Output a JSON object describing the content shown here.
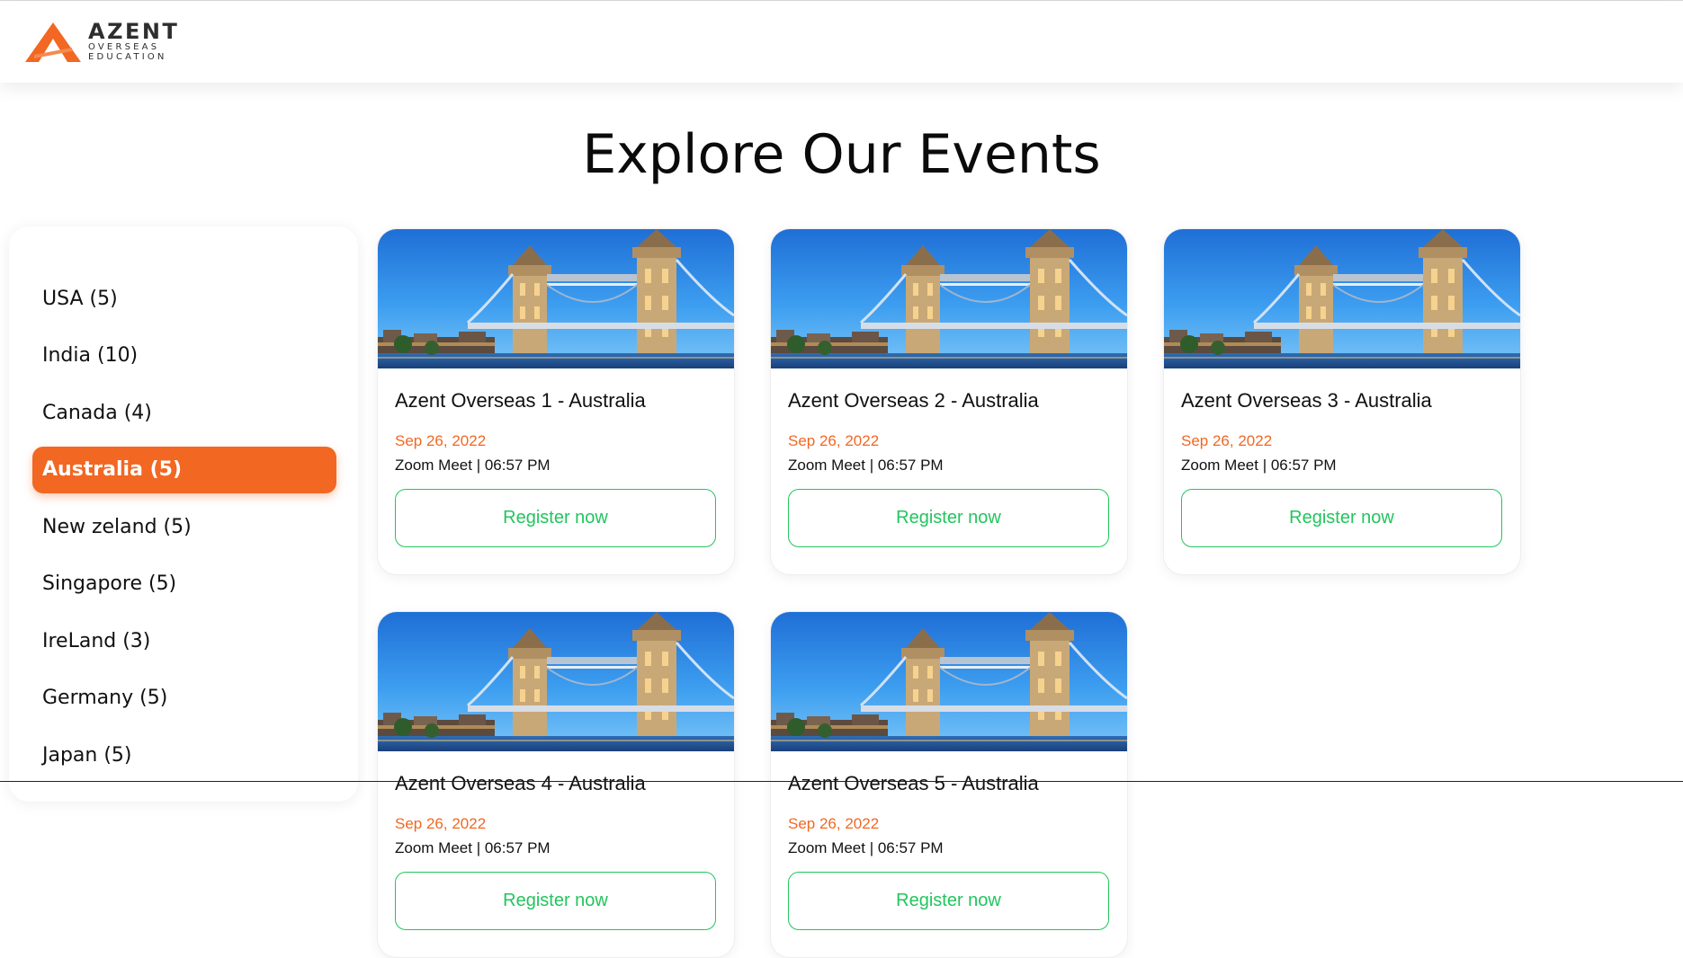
{
  "brand": {
    "name": "AZENT",
    "line1": "OVERSEAS",
    "line2": "EDUCATION",
    "accent": "#f26722"
  },
  "page": {
    "title": "Explore Our Events"
  },
  "countries": [
    {
      "label": "USA (5)"
    },
    {
      "label": "India (10)"
    },
    {
      "label": "Canada (4)"
    },
    {
      "label": "Australia (5)",
      "active": true
    },
    {
      "label": "New zeland (5)"
    },
    {
      "label": "Singapore (5)"
    },
    {
      "label": "IreLand (3)"
    },
    {
      "label": "Germany (5)"
    },
    {
      "label": "Japan (5)"
    }
  ],
  "events": [
    {
      "title": "Azent Overseas 1 - Australia",
      "date": "Sep 26, 2022",
      "meta": "Zoom Meet | 06:57 PM",
      "cta": "Register now",
      "image": "tower-bridge-photo"
    },
    {
      "title": "Azent Overseas 2 - Australia",
      "date": "Sep 26, 2022",
      "meta": "Zoom Meet | 06:57 PM",
      "cta": "Register now",
      "image": "tower-bridge-photo"
    },
    {
      "title": "Azent Overseas 3 - Australia",
      "date": "Sep 26, 2022",
      "meta": "Zoom Meet | 06:57 PM",
      "cta": "Register now",
      "image": "tower-bridge-photo"
    },
    {
      "title": "Azent Overseas 4 - Australia",
      "date": "Sep 26, 2022",
      "meta": "Zoom Meet | 06:57 PM",
      "cta": "Register now",
      "image": "tower-bridge-photo"
    },
    {
      "title": "Azent Overseas 5 - Australia",
      "date": "Sep 26, 2022",
      "meta": "Zoom Meet | 06:57 PM",
      "cta": "Register now",
      "image": "tower-bridge-photo"
    }
  ],
  "colors": {
    "accent": "#f26722",
    "cta": "#22c55e"
  }
}
